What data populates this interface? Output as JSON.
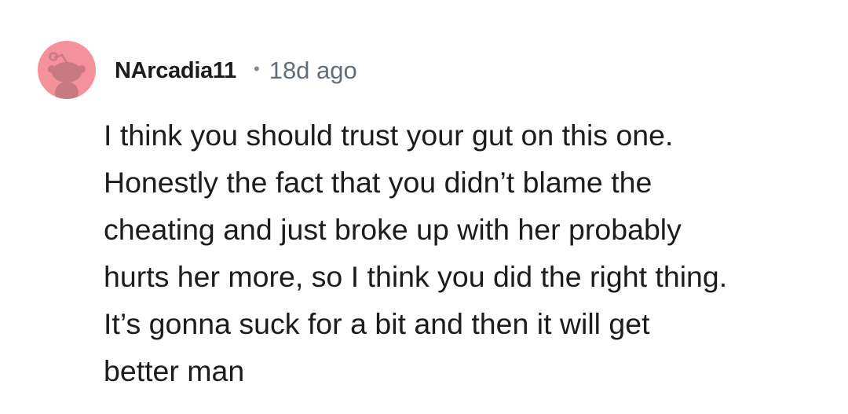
{
  "comment": {
    "author": "NArcadia11",
    "separator": "•",
    "timestamp": "18d ago",
    "avatar_icon": "reddit-snoo-avatar-icon",
    "avatar_color": "#f4919a",
    "body_lines": [
      "I think you should trust your gut on this one.",
      "Honestly the fact that you didn’t blame the",
      "cheating and just broke up with her probably",
      "hurts her more, so I think you did the right thing.",
      "It’s gonna suck for a bit and then it will get",
      "better man"
    ]
  }
}
